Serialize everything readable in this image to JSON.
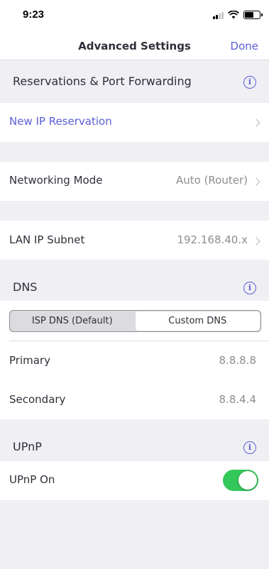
{
  "status_bar": {
    "time": "9:23"
  },
  "nav": {
    "title": "Advanced Settings",
    "done_label": "Done"
  },
  "sections": {
    "reservations": {
      "header": "Reservations & Port Forwarding",
      "new_reservation_label": "New IP Reservation"
    },
    "networking": {
      "label": "Networking Mode",
      "value": "Auto (Router)"
    },
    "lan": {
      "label": "LAN IP Subnet",
      "value": "192.168.40.x"
    },
    "dns": {
      "header": "DNS",
      "options": [
        "ISP DNS (Default)",
        "Custom DNS"
      ],
      "selected": "Custom DNS",
      "primary_label": "Primary",
      "primary_value": "8.8.8.8",
      "secondary_label": "Secondary",
      "secondary_value": "8.8.4.4"
    },
    "upnp": {
      "header": "UPnP",
      "toggle_label": "UPnP On",
      "enabled": true
    }
  },
  "colors": {
    "accent": "#5b5fd6",
    "toggle_on": "#34c759",
    "background": "#efeff4"
  }
}
